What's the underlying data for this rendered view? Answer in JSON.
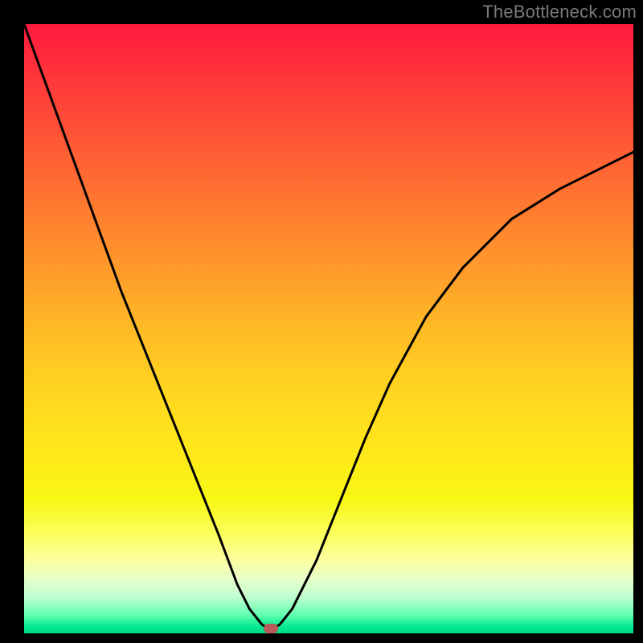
{
  "watermark": "TheBottleneck.com",
  "chart_data": {
    "type": "line",
    "title": "",
    "xlabel": "",
    "ylabel": "",
    "xlim": [
      0,
      100
    ],
    "ylim": [
      0,
      100
    ],
    "grid": false,
    "legend": false,
    "gradient_colors": {
      "top": "#ff1a3d",
      "mid": "#ffd520",
      "bottom": "#00d880"
    },
    "series": [
      {
        "name": "bottleneck-curve",
        "color": "#000000",
        "x": [
          0,
          4,
          8,
          12,
          16,
          20,
          24,
          28,
          32,
          35,
          37,
          39,
          40,
          41,
          42,
          44,
          48,
          52,
          56,
          60,
          66,
          72,
          80,
          88,
          96,
          100
        ],
        "y": [
          100,
          89,
          78,
          67,
          56,
          46,
          36,
          26,
          16,
          8,
          4,
          1.5,
          0.8,
          0.8,
          1.5,
          4,
          12,
          22,
          32,
          41,
          52,
          60,
          68,
          73,
          77,
          79
        ]
      }
    ],
    "marker": {
      "name": "optimal-point",
      "x": 40.5,
      "y": 0.8,
      "color": "#b85a5a"
    }
  }
}
